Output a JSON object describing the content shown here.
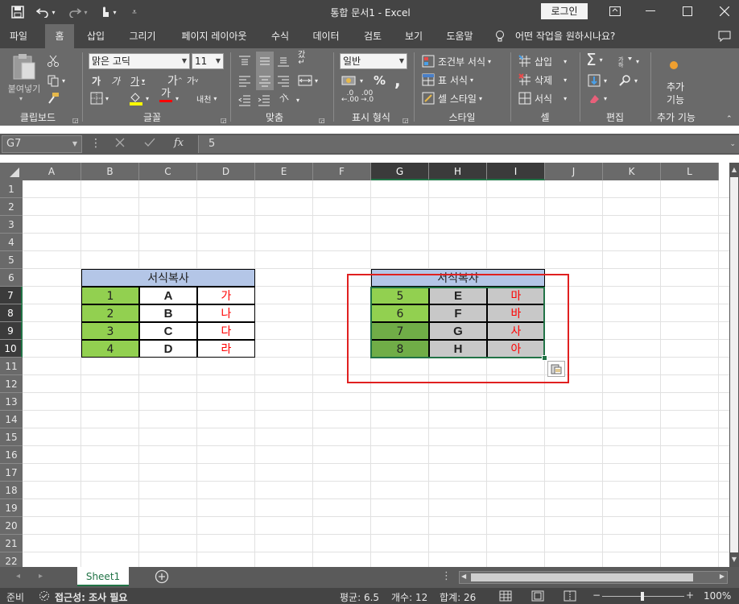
{
  "window": {
    "title": "통합 문서1  -  Excel",
    "login_label": "로그인"
  },
  "tabs": [
    {
      "label": "파일"
    },
    {
      "label": "홈"
    },
    {
      "label": "삽입"
    },
    {
      "label": "그리기"
    },
    {
      "label": "페이지 레이아웃"
    },
    {
      "label": "수식"
    },
    {
      "label": "데이터"
    },
    {
      "label": "검토"
    },
    {
      "label": "보기"
    },
    {
      "label": "도움말"
    },
    {
      "label": "어떤 작업을 원하시나요?"
    }
  ],
  "ribbon": {
    "paste_label": "붙여넣기",
    "font_name": "맑은 고딕",
    "font_size": "11",
    "number_format": "일반",
    "conditional_format": "조건부 서식",
    "table_format": "표 서식",
    "cell_style": "셀 스타일",
    "insert": "삽입",
    "delete": "삭제",
    "format": "서식",
    "addin": "추가\n기능",
    "groups": {
      "clipboard": "클립보드",
      "font": "글꼴",
      "align": "맞춤",
      "number": "표시 형식",
      "style": "스타일",
      "cells": "셀",
      "edit": "편집",
      "addins": "추가 기능"
    }
  },
  "formula_bar": {
    "name_box": "G7",
    "value": "5"
  },
  "columns": [
    "A",
    "B",
    "C",
    "D",
    "E",
    "F",
    "G",
    "H",
    "I",
    "J",
    "K",
    "L"
  ],
  "rows": [
    "1",
    "2",
    "3",
    "4",
    "5",
    "6",
    "7",
    "8",
    "9",
    "10",
    "11",
    "12",
    "13",
    "14",
    "15",
    "16",
    "17",
    "18",
    "19",
    "20",
    "21",
    "22"
  ],
  "table_left": {
    "header": "서식복사",
    "rows": [
      [
        "1",
        "A",
        "가"
      ],
      [
        "2",
        "B",
        "나"
      ],
      [
        "3",
        "C",
        "다"
      ],
      [
        "4",
        "D",
        "라"
      ]
    ]
  },
  "table_right": {
    "header": "서식복사",
    "rows": [
      [
        "5",
        "E",
        "마"
      ],
      [
        "6",
        "F",
        "바"
      ],
      [
        "7",
        "G",
        "사"
      ],
      [
        "8",
        "H",
        "아"
      ]
    ]
  },
  "sheet_tab": "Sheet1",
  "status": {
    "ready": "준비",
    "accessibility": "접근성: 조사 필요",
    "average": "평균: 6.5",
    "count": "개수: 12",
    "sum": "합계: 26",
    "zoom": "100%"
  },
  "colors": {
    "green_light": "#92d050",
    "green_dark": "#70ad47",
    "header_blue": "#b4c6e7",
    "red_text": "#ff0000",
    "highlight_box": "#e02020"
  }
}
